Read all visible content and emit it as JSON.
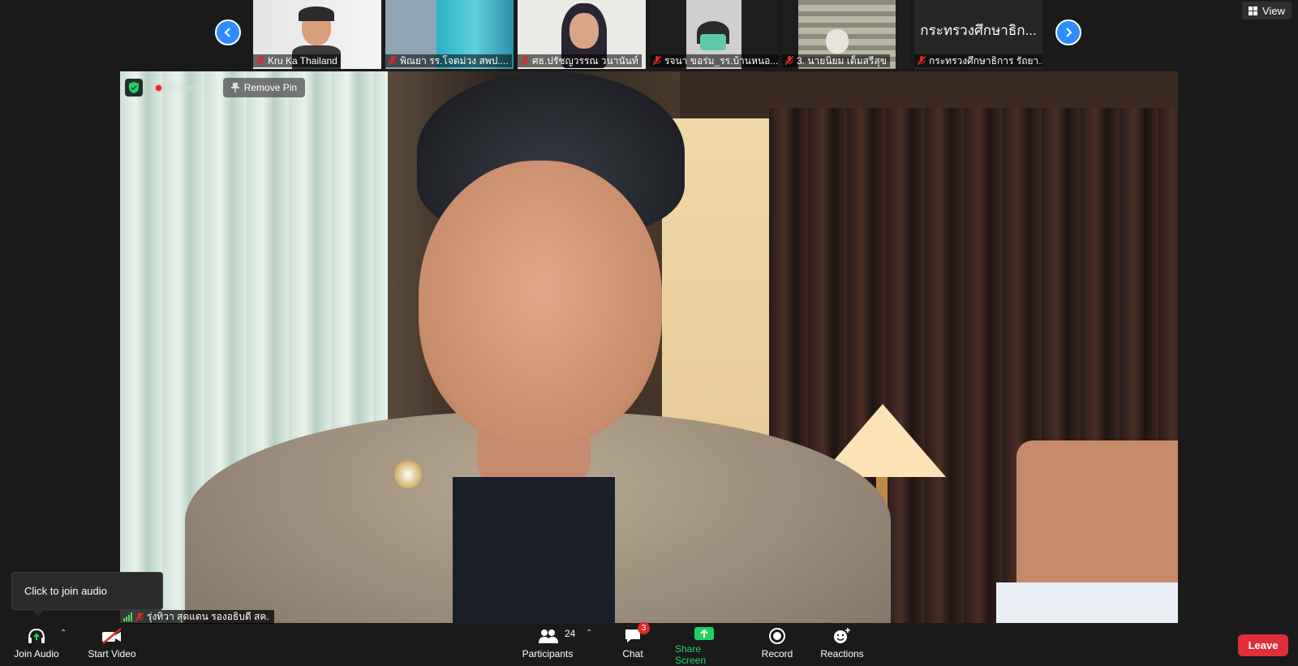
{
  "top_strip": {
    "participants": [
      {
        "name": "Kru Ka Thailand",
        "mic": "muted-mic-icon"
      },
      {
        "name": "พิณยา รร.โจดม่วง สพป....",
        "mic": "muted-mic-icon"
      },
      {
        "name": "ศธ.ปรัชญวรรณ วนานันท์",
        "mic": "muted-mic-icon"
      },
      {
        "name": "รจนา ขอร่ม_รร.บ้านหนอ...",
        "mic": "muted-mic-icon"
      },
      {
        "name": "3. นายนิยม เต็มสรีสุข",
        "mic": "muted-mic-icon"
      },
      {
        "name": "กระทรวงศึกษาธิการ รัถยา...",
        "display_name": "กระทรวงศึกษาธิก...",
        "mic": "muted-mic-icon"
      }
    ],
    "view_label": "View"
  },
  "main_video": {
    "recording_label": "Recording",
    "remove_pin_label": "Remove Pin",
    "speaker_name": "รุ่งทิวา สุดแดน รองอธิบดี สค."
  },
  "tooltip": {
    "text": "Click to join audio"
  },
  "toolbar": {
    "join_audio": "Join Audio",
    "start_video": "Start Video",
    "participants": "Participants",
    "participants_count": "24",
    "chat": "Chat",
    "chat_badge": "3",
    "share_screen": "Share Screen",
    "record": "Record",
    "reactions": "Reactions",
    "leave": "Leave"
  },
  "colors": {
    "accent_blue": "#2d8cff",
    "leave_red": "#e02f3b",
    "share_green": "#23d160",
    "background": "#1a1a1a"
  }
}
